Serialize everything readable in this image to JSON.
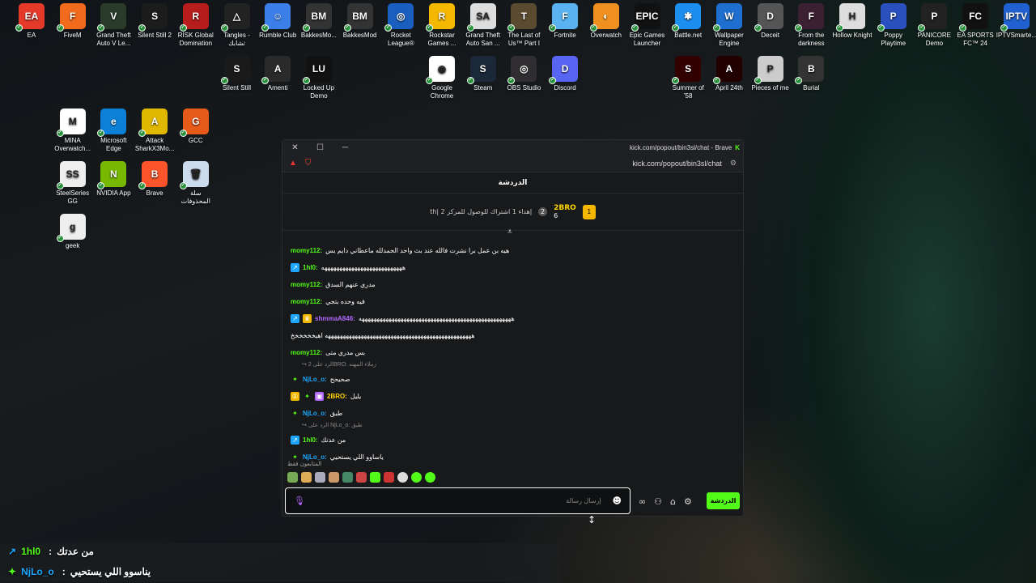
{
  "desktop_icons": [
    {
      "label": "EA",
      "color": "#e53a2a",
      "glyph": "EA"
    },
    {
      "label": "FiveM",
      "color": "#f26b1d",
      "glyph": "F"
    },
    {
      "label": "Grand Theft Auto V Le...",
      "color": "#2a3b2a",
      "glyph": "V"
    },
    {
      "label": "Silent Still 2",
      "color": "#1c1c1c",
      "glyph": "S"
    },
    {
      "label": "RISK Global Domination",
      "color": "#b81d1d",
      "glyph": "R"
    },
    {
      "label": "Tangles - تشابك",
      "color": "#222",
      "glyph": "△"
    },
    {
      "label": "Rumble Club",
      "color": "#3d7fe8",
      "glyph": "☺"
    },
    {
      "label": "BakkesMo...",
      "color": "#333",
      "glyph": "BM"
    },
    {
      "label": "BakkesMod",
      "color": "#333",
      "glyph": "BM"
    },
    {
      "label": "Rocket League®",
      "color": "#1a5fbf",
      "glyph": "◎"
    },
    {
      "label": "Rockstar Games ...",
      "color": "#f5b800",
      "glyph": "R"
    },
    {
      "label": "Grand Theft Auto San ...",
      "color": "#ddd",
      "glyph": "SA"
    },
    {
      "label": "The Last of Us™ Part I",
      "color": "#5a4a30",
      "glyph": "T"
    },
    {
      "label": "Fortnite",
      "color": "#5ab2f0",
      "glyph": "F"
    },
    {
      "label": "Overwatch",
      "color": "#f09020",
      "glyph": "◐"
    },
    {
      "label": "Epic Games Launcher",
      "color": "#111",
      "glyph": "EPIC"
    },
    {
      "label": "Battle.net",
      "color": "#1c8ef0",
      "glyph": "✱"
    },
    {
      "label": "Wallpaper Engine",
      "color": "#1f6fd1",
      "glyph": "W"
    },
    {
      "label": "Deceit",
      "color": "#555",
      "glyph": "D"
    },
    {
      "label": "From the darkness",
      "color": "#3a2030",
      "glyph": "F"
    },
    {
      "label": "Hollow Knight",
      "color": "#ddd",
      "glyph": "H"
    },
    {
      "label": "Poppy Playtime",
      "color": "#2a50c0",
      "glyph": "P"
    },
    {
      "label": "PANICORE Demo",
      "color": "#222",
      "glyph": "P"
    },
    {
      "label": "EA SPORTS FC™ 24",
      "color": "#111",
      "glyph": "FC"
    },
    {
      "label": "IPTVSmarte...",
      "color": "#2060d0",
      "glyph": "IPTV"
    },
    {
      "label": "Silent Still",
      "color": "#1a1a1a",
      "glyph": "S"
    },
    {
      "label": "Amenti",
      "color": "#2a2a2a",
      "glyph": "A"
    },
    {
      "label": "Locked Up Demo",
      "color": "#111",
      "glyph": "LU"
    },
    {
      "label": "Google Chrome",
      "color": "#fff",
      "glyph": "◉"
    },
    {
      "label": "Steam",
      "color": "#1b2838",
      "glyph": "S"
    },
    {
      "label": "OBS Studio",
      "color": "#302e31",
      "glyph": "◎"
    },
    {
      "label": "Discord",
      "color": "#5865f2",
      "glyph": "D"
    },
    {
      "label": "Summer of '58",
      "color": "#300",
      "glyph": "S"
    },
    {
      "label": "April 24th",
      "color": "#200",
      "glyph": "A"
    },
    {
      "label": "Pieces of me",
      "color": "#ccc",
      "glyph": "P"
    },
    {
      "label": "Burial",
      "color": "#333",
      "glyph": "B"
    },
    {
      "label": "MINA Overwatch...",
      "color": "#fff",
      "glyph": "M"
    },
    {
      "label": "Microsoft Edge",
      "color": "#0c7fd6",
      "glyph": "e"
    },
    {
      "label": "Attack SharkX3Mo...",
      "color": "#e0b800",
      "glyph": "A"
    },
    {
      "label": "GCC",
      "color": "#e85a1a",
      "glyph": "G"
    },
    {
      "label": "SteelSeries GG",
      "color": "#eee",
      "glyph": "SS"
    },
    {
      "label": "NVIDIA App",
      "color": "#76b900",
      "glyph": "N"
    },
    {
      "label": "Brave",
      "color": "#fb542b",
      "glyph": "B"
    },
    {
      "label": "سلة المحذوفات",
      "color": "#cde",
      "glyph": "🗑"
    },
    {
      "label": "geek",
      "color": "#eee",
      "glyph": "g"
    }
  ],
  "window": {
    "title": "kick.com/popout/bin3sl/chat - Brave",
    "url": "kick.com/popout/bin3sl/chat",
    "chat_header": "الدردشة",
    "pinned": {
      "rank": "1",
      "user": "2BRO",
      "count": "6",
      "text": "th| إهداء 1 اشتراك للوصول للمركز 2"
    },
    "messages": [
      {
        "user": "momy112",
        "color": "#53fc18",
        "text": "هيه بن عمل برا نشرت فالله عند بث واحد الحمدلله ماعطاني دايم بس",
        "badges": ""
      },
      {
        "user": "1hl0",
        "color": "#53fc18",
        "text": "هههههههههههههههههههههههههههه",
        "badges": "↗"
      },
      {
        "user": "momy112",
        "color": "#53fc18",
        "text": "مدري عنهم السدق",
        "badges": ""
      },
      {
        "user": "momy112",
        "color": "#53fc18",
        "text": "فيه وحده بتجي",
        "badges": ""
      },
      {
        "user": "shmmaA846",
        "color": "#b368ff",
        "text": "هههههههههههههههههههههههههههههههههههههههههههههههههههه",
        "badges": "↗♛"
      },
      {
        "user": "",
        "color": "#fff",
        "text": "هههههههههههههههههههههههههههههههههههههههههههههههههه اهيخخخخخخ",
        "badges": ""
      },
      {
        "user": "momy112",
        "color": "#53fc18",
        "text": "بس مدري متى",
        "badges": ""
      },
      {
        "reply": "الرد على 2BRO: زملاء المهنه"
      },
      {
        "user": "NjLo_o",
        "color": "#1ea7fd",
        "text": "صحيحح",
        "badges": "✦"
      },
      {
        "user": "2BRO",
        "color": "#ffd700",
        "text": "يليل",
        "badges": "①✦▣"
      },
      {
        "user": "NjLo_o",
        "color": "#1ea7fd",
        "text": "طبق",
        "badges": "✦"
      },
      {
        "reply": "الرد على NjLo_o: طبق"
      },
      {
        "user": "1hl0",
        "color": "#53fc18",
        "text": "من عدتك",
        "badges": "↗"
      },
      {
        "user": "NjLo_o",
        "color": "#1ea7fd",
        "text": "ياساوو اللي يستحيي",
        "badges": "✦"
      }
    ],
    "followers_only": "المتابعون فقط",
    "input_placeholder": "إرسال رسالة",
    "send_label": "الدردشة"
  },
  "overlay": [
    {
      "user": "1hl0",
      "text": "من عدتك"
    },
    {
      "user": "NjLo_o",
      "text": "يناسوو اللي يستحيي"
    }
  ]
}
